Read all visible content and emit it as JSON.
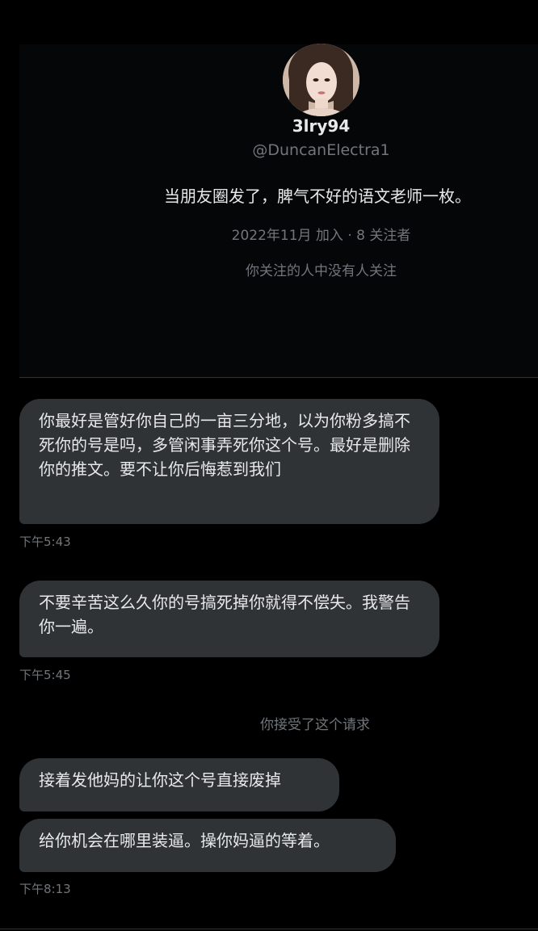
{
  "profile": {
    "display_name": "3lry94",
    "handle": "@DuncanElectra1",
    "bio": "当朋友圈发了，脾气不好的语文老师一枚。",
    "meta": "2022年11月 加入 · 8 关注者",
    "followers_note": "你关注的人中没有人关注"
  },
  "messages": [
    {
      "text": "你最好是管好你自己的一亩三分地，以为你粉多搞不死你的号是吗，多管闲事弄死你这个号。最好是删除你的推文。要不让你后悔惹到我们",
      "time": "下午5:43"
    },
    {
      "text": "不要辛苦这么久你的号搞死掉你就得不偿失。我警告你一遍。",
      "time": "下午5:45"
    },
    {
      "text": "接着发他妈的让你这个号直接废掉",
      "time": ""
    },
    {
      "text": "给你机会在哪里装逼。操你妈逼的等着。",
      "time": "下午8:13"
    }
  ],
  "system_note": "你接受了这个请求"
}
